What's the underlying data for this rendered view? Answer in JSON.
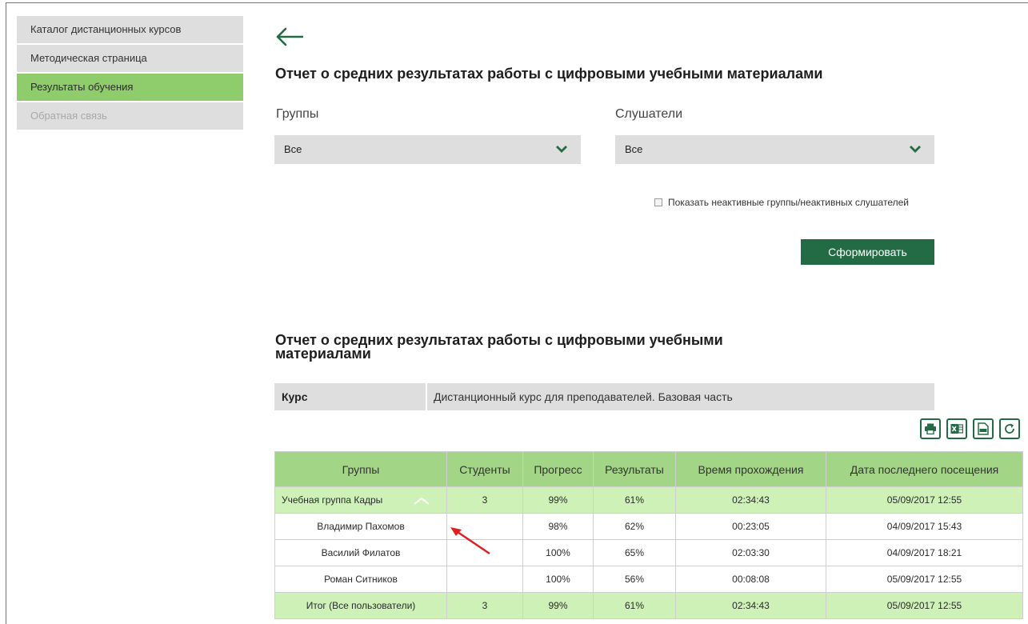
{
  "sidebar": {
    "items": [
      {
        "label": "Каталог дистанционных курсов",
        "state": "normal"
      },
      {
        "label": "Методическая страница",
        "state": "normal"
      },
      {
        "label": "Результаты обучения",
        "state": "active"
      },
      {
        "label": "Обратная связь",
        "state": "disabled"
      }
    ]
  },
  "header": {
    "back_icon": "arrow-left-icon",
    "title": "Отчет о средних результатах работы с цифровыми учебными материалами"
  },
  "filters": {
    "groups_label": "Группы",
    "groups_value": "Все",
    "listeners_label": "Слушатели",
    "listeners_value": "Все",
    "inactive_label": "Показать неактивные группы/неактивных слушателей",
    "generate_button": "Сформировать"
  },
  "report": {
    "title": "Отчет о средних результатах работы с цифровыми учебными материалами",
    "course_key": "Курс",
    "course_value": "Дистанционный курс для преподавателей. Базовая часть",
    "tools": [
      "print-icon",
      "excel-icon",
      "pdf-icon",
      "refresh-icon"
    ],
    "columns": [
      "Группы",
      "Студенты",
      "Прогресс",
      "Результаты",
      "Время прохождения",
      "Дата последнего посещения"
    ],
    "rows": [
      {
        "name": "Учебная группа Кадры",
        "students": "3",
        "progress": "99%",
        "results": "61%",
        "time": "02:34:43",
        "date": "05/09/2017 12:55",
        "kind": "group"
      },
      {
        "name": "Владимир Пахомов",
        "students": "",
        "progress": "98%",
        "results": "62%",
        "time": "00:23:05",
        "date": "04/09/2017 15:43",
        "kind": "person"
      },
      {
        "name": "Василий Филатов",
        "students": "",
        "progress": "100%",
        "results": "65%",
        "time": "02:03:30",
        "date": "04/09/2017 18:21",
        "kind": "person"
      },
      {
        "name": "Роман Ситников",
        "students": "",
        "progress": "100%",
        "results": "56%",
        "time": "00:08:08",
        "date": "05/09/2017 12:55",
        "kind": "person"
      },
      {
        "name": "Итог (Все пользователи)",
        "students": "3",
        "progress": "99%",
        "results": "61%",
        "time": "02:34:43",
        "date": "05/09/2017 12:55",
        "kind": "total"
      }
    ]
  },
  "colors": {
    "accent": "#236b45",
    "active_green": "#8fcc6b",
    "row_green": "#cef1b8",
    "annotation": "#e02020"
  }
}
